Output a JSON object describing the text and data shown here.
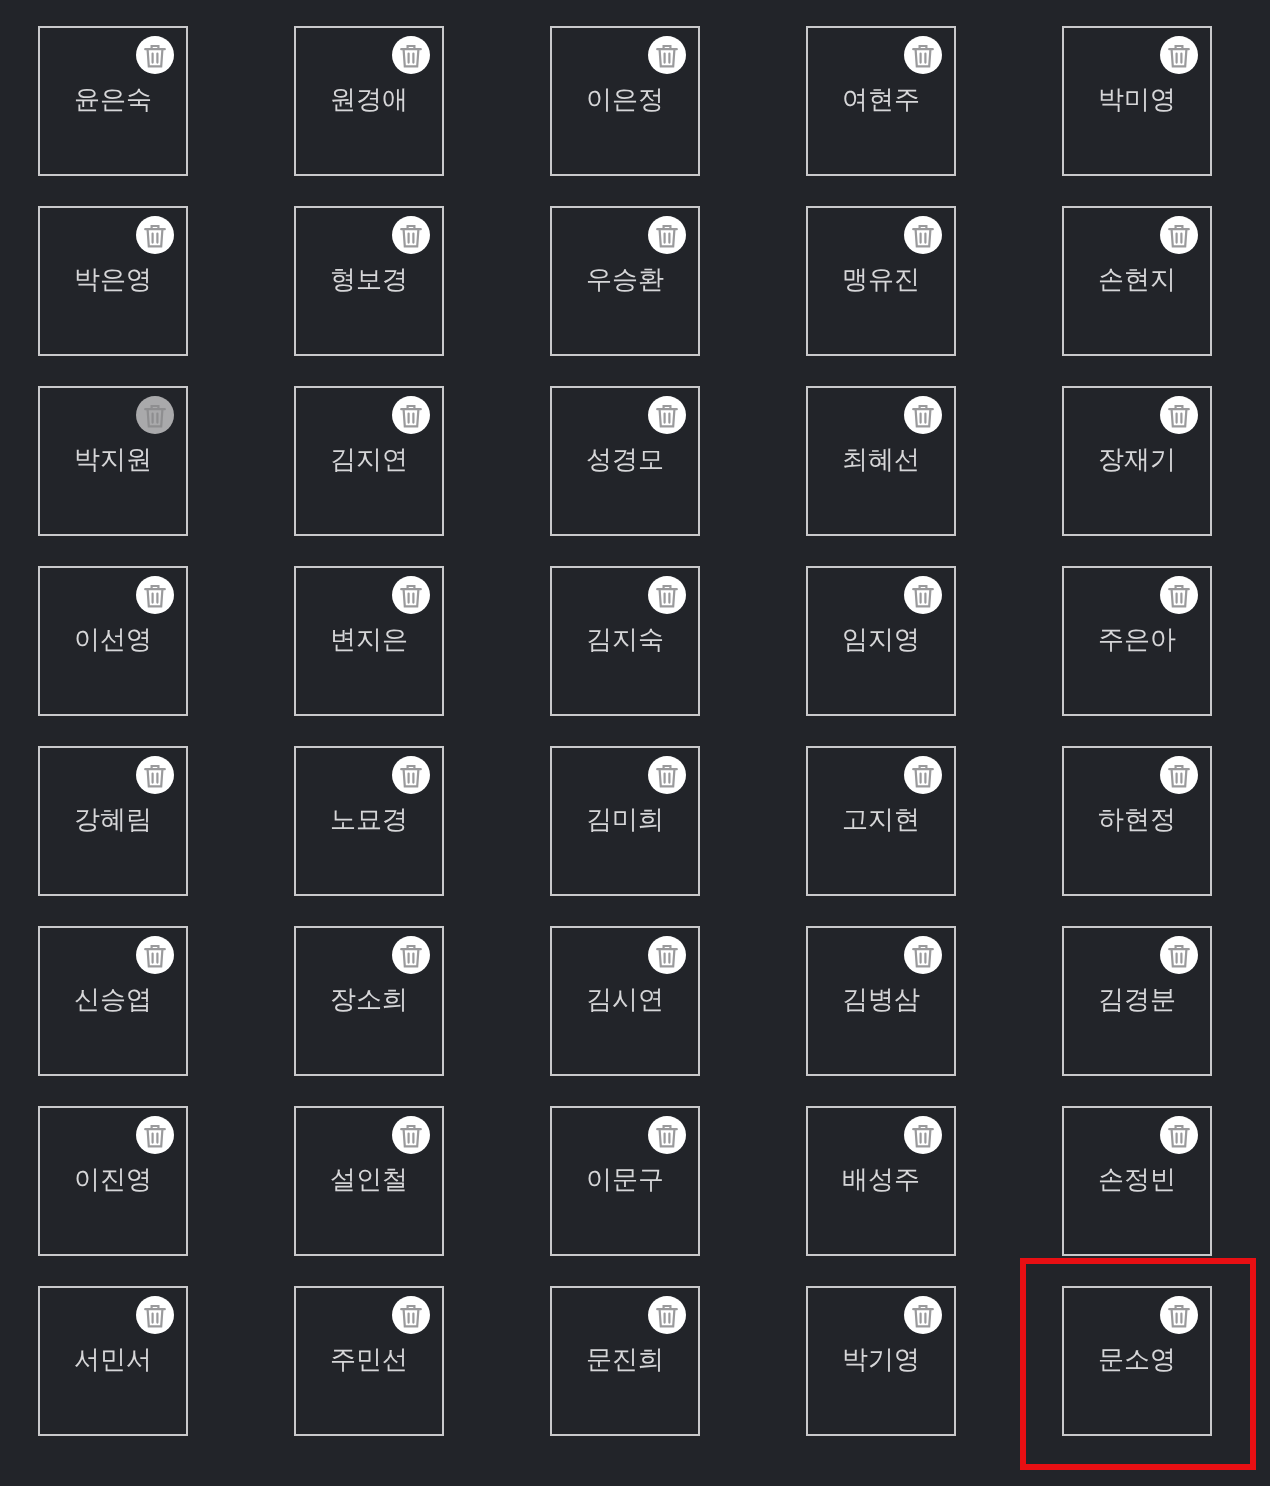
{
  "cards": [
    {
      "name": "윤은숙",
      "delete_disabled": false,
      "highlighted": false
    },
    {
      "name": "원경애",
      "delete_disabled": false,
      "highlighted": false
    },
    {
      "name": "이은정",
      "delete_disabled": false,
      "highlighted": false
    },
    {
      "name": "여현주",
      "delete_disabled": false,
      "highlighted": false
    },
    {
      "name": "박미영",
      "delete_disabled": false,
      "highlighted": false
    },
    {
      "name": "박은영",
      "delete_disabled": false,
      "highlighted": false
    },
    {
      "name": "형보경",
      "delete_disabled": false,
      "highlighted": false
    },
    {
      "name": "우승환",
      "delete_disabled": false,
      "highlighted": false
    },
    {
      "name": "맹유진",
      "delete_disabled": false,
      "highlighted": false
    },
    {
      "name": "손현지",
      "delete_disabled": false,
      "highlighted": false
    },
    {
      "name": "박지원",
      "delete_disabled": true,
      "highlighted": false
    },
    {
      "name": "김지연",
      "delete_disabled": false,
      "highlighted": false
    },
    {
      "name": "성경모",
      "delete_disabled": false,
      "highlighted": false
    },
    {
      "name": "최혜선",
      "delete_disabled": false,
      "highlighted": false
    },
    {
      "name": "장재기",
      "delete_disabled": false,
      "highlighted": false
    },
    {
      "name": "이선영",
      "delete_disabled": false,
      "highlighted": false
    },
    {
      "name": "변지은",
      "delete_disabled": false,
      "highlighted": false
    },
    {
      "name": "김지숙",
      "delete_disabled": false,
      "highlighted": false
    },
    {
      "name": "임지영",
      "delete_disabled": false,
      "highlighted": false
    },
    {
      "name": "주은아",
      "delete_disabled": false,
      "highlighted": false
    },
    {
      "name": "강혜림",
      "delete_disabled": false,
      "highlighted": false
    },
    {
      "name": "노묘경",
      "delete_disabled": false,
      "highlighted": false
    },
    {
      "name": "김미희",
      "delete_disabled": false,
      "highlighted": false
    },
    {
      "name": "고지현",
      "delete_disabled": false,
      "highlighted": false
    },
    {
      "name": "하현정",
      "delete_disabled": false,
      "highlighted": false
    },
    {
      "name": "신승엽",
      "delete_disabled": false,
      "highlighted": false
    },
    {
      "name": "장소희",
      "delete_disabled": false,
      "highlighted": false
    },
    {
      "name": "김시연",
      "delete_disabled": false,
      "highlighted": false
    },
    {
      "name": "김병삼",
      "delete_disabled": false,
      "highlighted": false
    },
    {
      "name": "김경분",
      "delete_disabled": false,
      "highlighted": false
    },
    {
      "name": "이진영",
      "delete_disabled": false,
      "highlighted": false
    },
    {
      "name": "설인철",
      "delete_disabled": false,
      "highlighted": false
    },
    {
      "name": "이문구",
      "delete_disabled": false,
      "highlighted": false
    },
    {
      "name": "배성주",
      "delete_disabled": false,
      "highlighted": false
    },
    {
      "name": "손정빈",
      "delete_disabled": false,
      "highlighted": false
    },
    {
      "name": "서민서",
      "delete_disabled": false,
      "highlighted": false
    },
    {
      "name": "주민선",
      "delete_disabled": false,
      "highlighted": false
    },
    {
      "name": "문진희",
      "delete_disabled": false,
      "highlighted": false
    },
    {
      "name": "박기영",
      "delete_disabled": false,
      "highlighted": false
    },
    {
      "name": "문소영",
      "delete_disabled": false,
      "highlighted": true
    }
  ]
}
